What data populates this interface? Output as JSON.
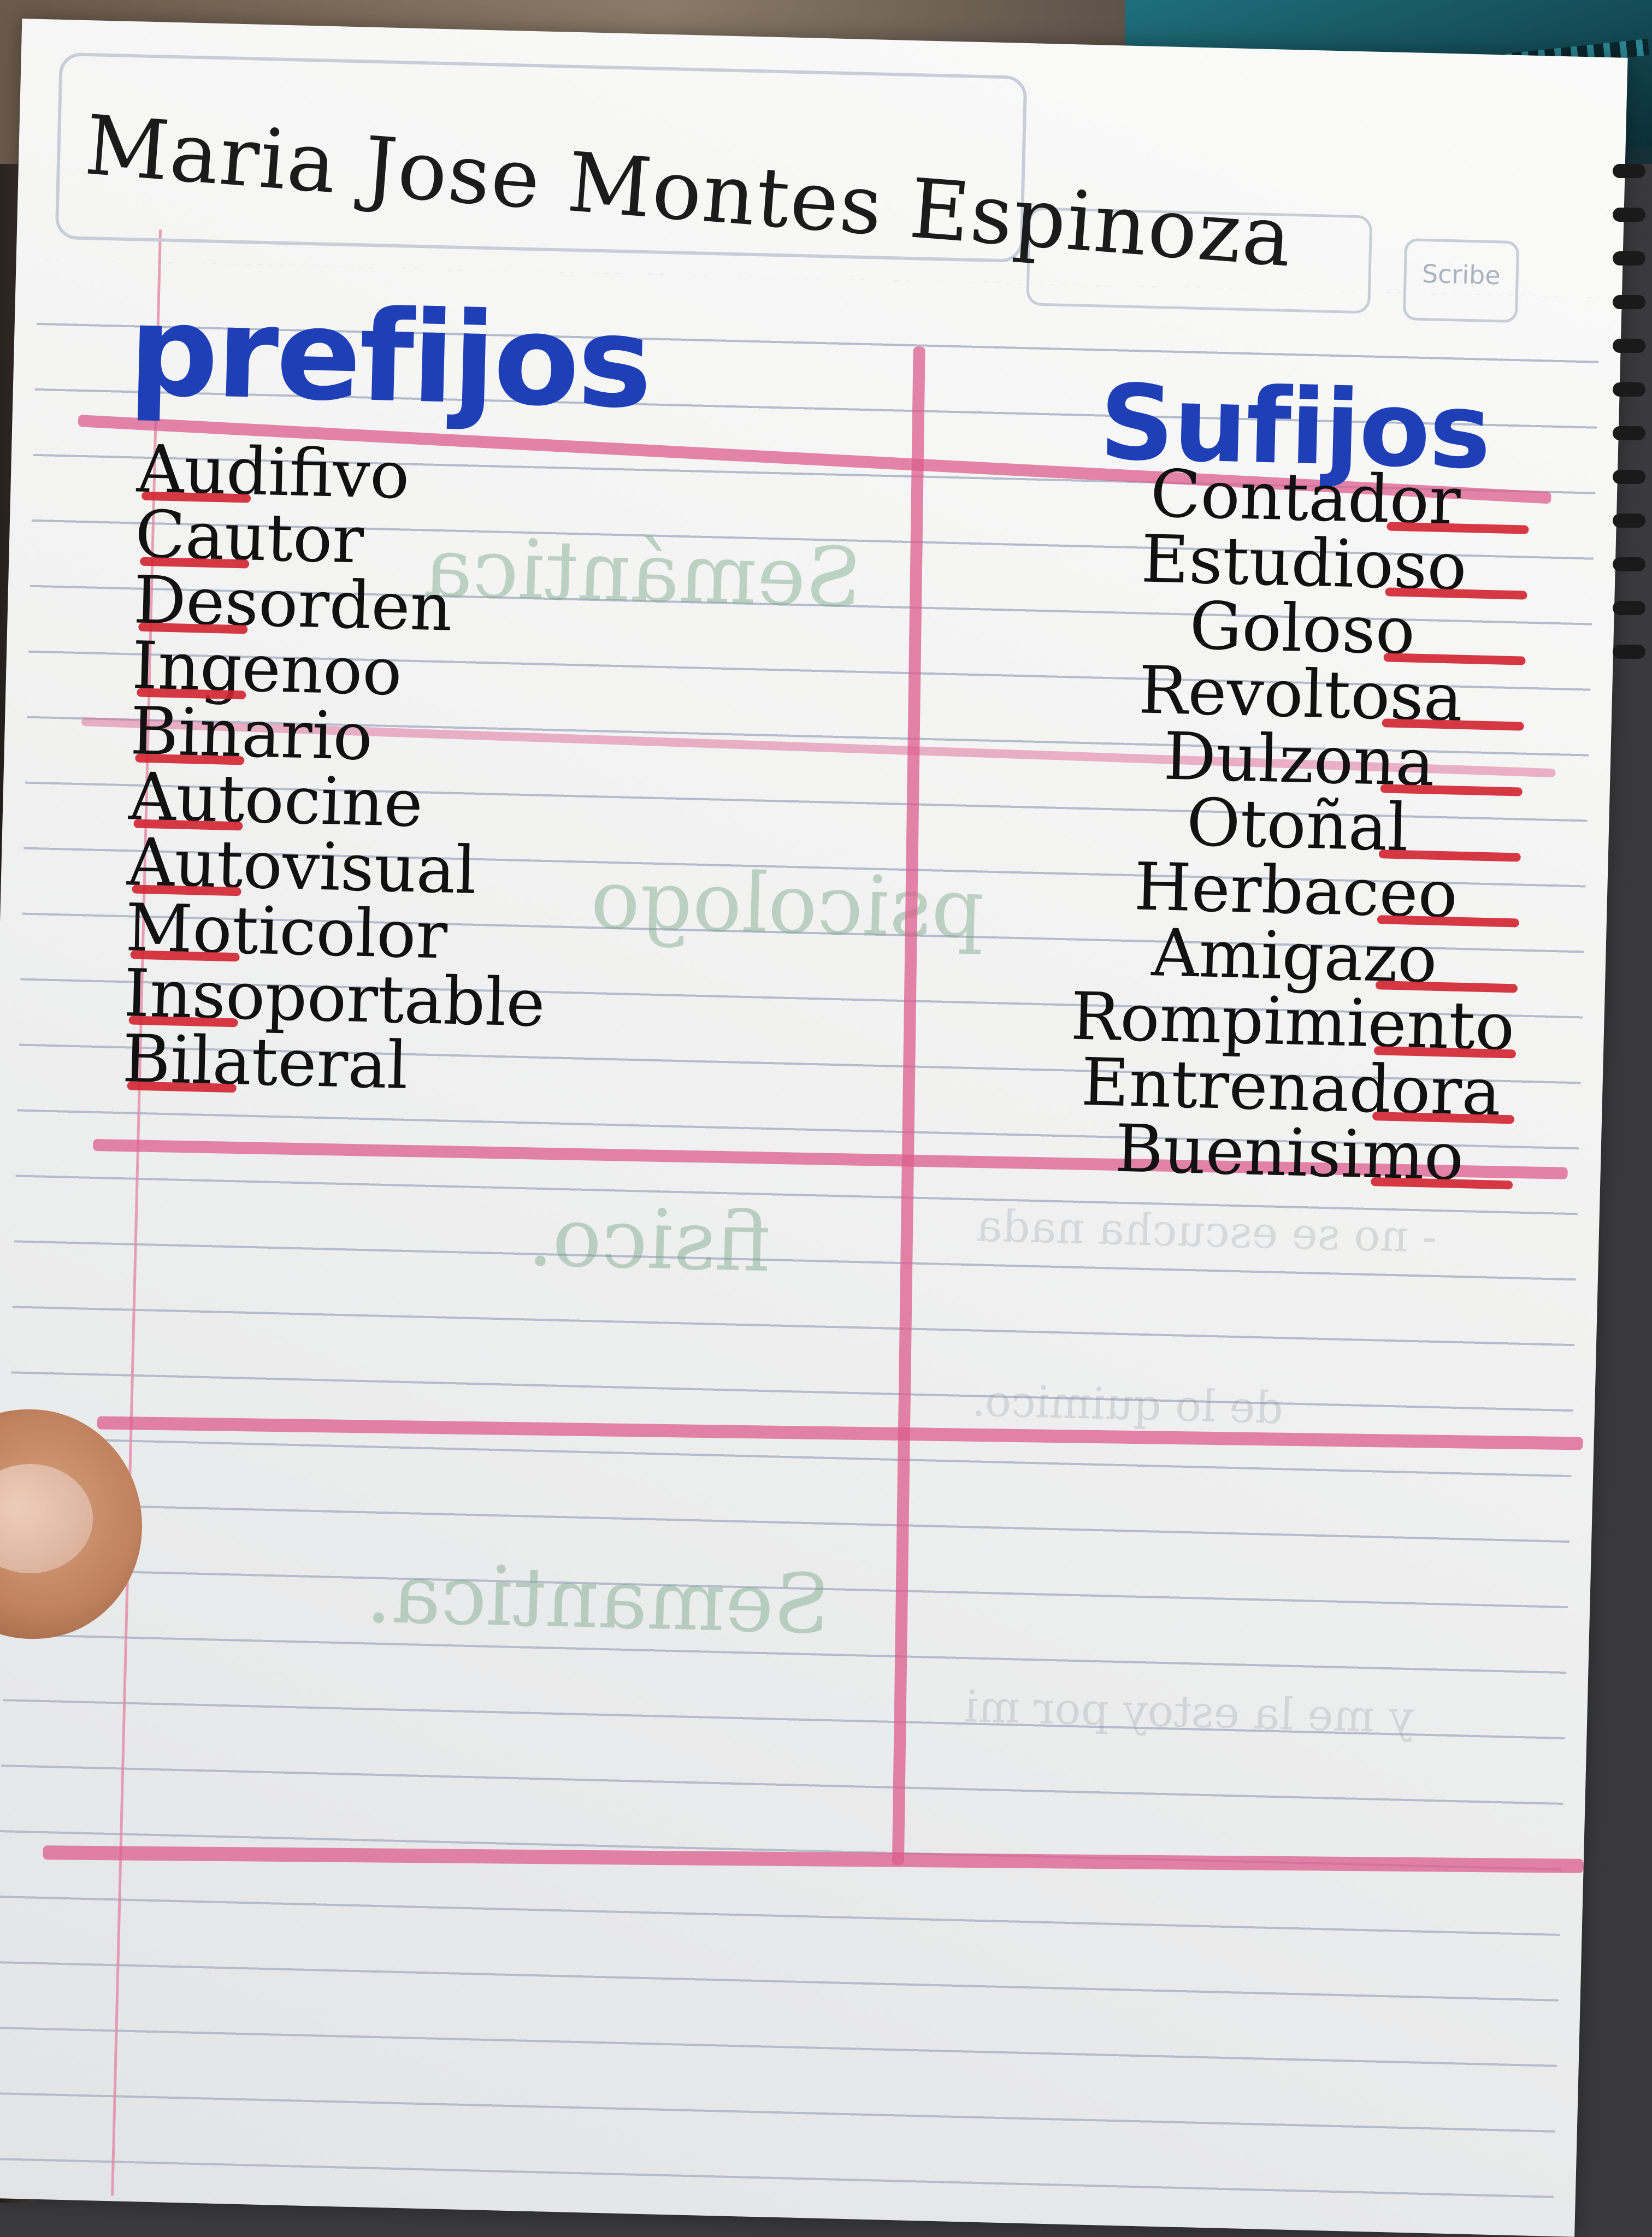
{
  "header": {
    "student_name": "Maria Jose Montes Espinoza",
    "notebook_logo": "Scribe"
  },
  "table": {
    "left_heading": "prefijos",
    "right_heading": "Sufijos",
    "prefijos": [
      "Audifivo",
      "Cautor",
      "Desorden",
      "Ingenoo",
      "Binario",
      "Autocine",
      "Autovisual",
      "Moticolor",
      "Insoportable",
      "Bilateral"
    ],
    "sufijos": [
      "Contador",
      "Estudioso",
      "Goloso",
      "Revoltosa",
      "Dulzona",
      "Otoñal",
      "Herbaceo",
      "Amigazo",
      "Rompimiento",
      "Entrenadora",
      "Buenisimo"
    ]
  },
  "colors": {
    "heading_ink": "#1f3fb6",
    "underline_red": "#d22430",
    "table_line_pink": "#dc5c8c"
  }
}
